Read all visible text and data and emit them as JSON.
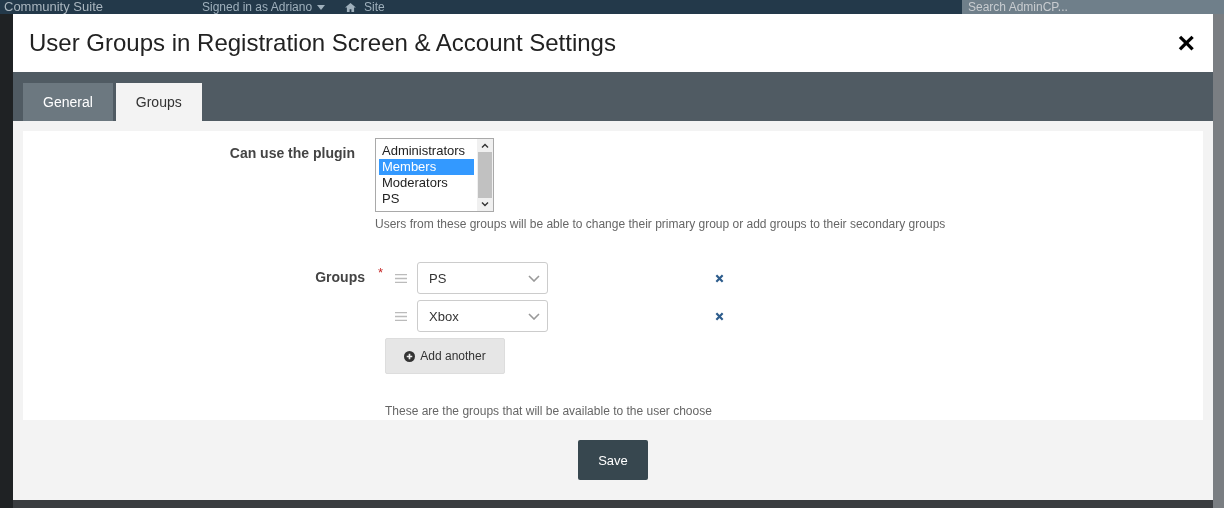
{
  "backdrop": {
    "brand": "Community Suite",
    "signed_in": "Signed in as Adriano",
    "site_link": "Site",
    "search": {
      "placeholder": "Search AdminCP..."
    }
  },
  "modal": {
    "title": "User Groups in Registration Screen & Account Settings",
    "close": "×"
  },
  "tabs": [
    {
      "label": "General",
      "selected": false
    },
    {
      "label": "Groups",
      "selected": true
    }
  ],
  "form": {
    "plugin_field": {
      "label": "Can use the plugin",
      "options": [
        {
          "label": "Administrators",
          "selected": false
        },
        {
          "label": "Members",
          "selected": true
        },
        {
          "label": "Moderators",
          "selected": false
        },
        {
          "label": "PS",
          "selected": false
        }
      ],
      "description": "Users from these groups will be able to change their primary group or add groups to their secondary groups"
    },
    "groups_field": {
      "label": "Groups",
      "required": true,
      "required_mark": "*",
      "items": [
        {
          "value": "PS"
        },
        {
          "value": "Xbox"
        }
      ],
      "add_button": "Add another",
      "description": "These are the groups that will be available to the user choose"
    }
  },
  "footer": {
    "save_button": "Save"
  }
}
